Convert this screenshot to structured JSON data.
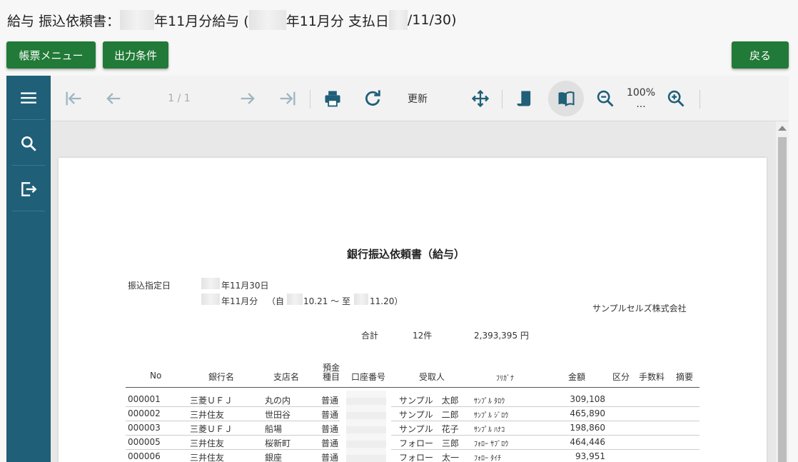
{
  "header": {
    "title_prefix": "給与 振込依頼書：",
    "title_part2": "年11月分給与 (",
    "title_part3": "年11月分 支払日",
    "title_part4": "/11/30)"
  },
  "buttons": {
    "menu": "帳票メニュー",
    "conditions": "出力条件",
    "back": "戻る"
  },
  "toolbar": {
    "page_indicator": "1 / 1",
    "refresh": "更新",
    "zoom": "100%",
    "zoom_more": "..."
  },
  "icons": {
    "side": [
      "hamburger-menu-icon",
      "search-icon",
      "export-icon"
    ],
    "toolbar": [
      "first-page-icon",
      "prev-page-icon",
      "next-page-icon",
      "last-page-icon",
      "print-icon",
      "refresh-icon",
      "move-icon",
      "continuous-scroll-icon",
      "book-view-icon",
      "zoom-out-icon",
      "zoom-in-icon"
    ]
  },
  "colors": {
    "accent_green": "#217a37",
    "sidebar": "#1f5f78"
  },
  "report": {
    "title": "銀行振込依頼書（給与）",
    "transfer_date_label": "振込指定日",
    "transfer_date": "年11月30日",
    "period_month": "年11月分",
    "period_from_label": "（自",
    "period_from": "10.21 ～ 至",
    "period_to": "11.20）",
    "company": "サンプルセルズ株式会社",
    "total_label": "合計",
    "total_count": "12件",
    "total_amount": "2,393,395 円",
    "columns": {
      "no": "No",
      "bank": "銀行名",
      "branch": "支店名",
      "deposit_line1": "預金",
      "deposit_line2": "種目",
      "account": "口座番号",
      "recipient": "受取人",
      "kana": "ﾌﾘｶﾞﾅ",
      "amount": "金額",
      "category": "区分",
      "fee": "手数料",
      "remarks": "摘要"
    },
    "rows": [
      {
        "no": "000001",
        "bank": "三菱ＵＦＪ",
        "branch": "丸の内",
        "type": "普通",
        "recipient": "サンプル　太郎",
        "kana": "ｻﾝﾌﾟﾙ ﾀﾛｳ",
        "amount": "309,108"
      },
      {
        "no": "000002",
        "bank": "三井住友",
        "branch": "世田谷",
        "type": "普通",
        "recipient": "サンプル　二郎",
        "kana": "ｻﾝﾌﾟﾙ ｼﾞﾛｳ",
        "amount": "465,890"
      },
      {
        "no": "000003",
        "bank": "三菱ＵＦＪ",
        "branch": "船場",
        "type": "普通",
        "recipient": "サンプル　花子",
        "kana": "ｻﾝﾌﾟﾙ ﾊﾅｺ",
        "amount": "198,860"
      },
      {
        "no": "000005",
        "bank": "三井住友",
        "branch": "桜新町",
        "type": "普通",
        "recipient": "フォロー　三郎",
        "kana": "ﾌｫﾛｰ ｻﾌﾞﾛｳ",
        "amount": "464,446"
      },
      {
        "no": "000006",
        "bank": "三井住友",
        "branch": "銀座",
        "type": "普通",
        "recipient": "フォロー　太一",
        "kana": "ﾌｫﾛｰ ﾀｲﾁ",
        "amount": "93,951"
      }
    ]
  }
}
